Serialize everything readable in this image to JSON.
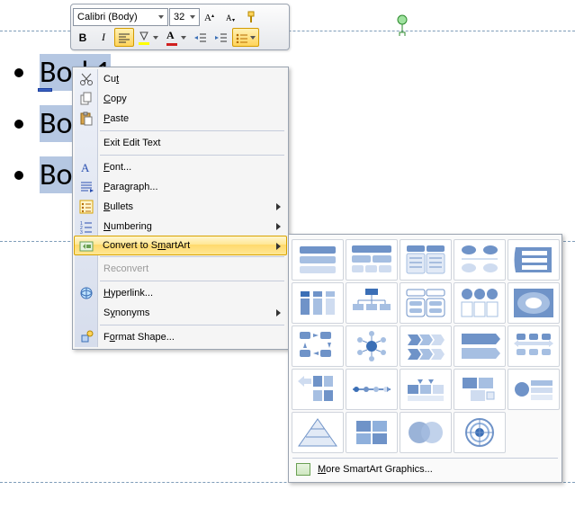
{
  "toolbar": {
    "font_name": "Calibri (Body)",
    "font_size": "32"
  },
  "bullets": {
    "items": [
      "Bod 1",
      "Bo",
      "Bo"
    ]
  },
  "context_menu": {
    "cut": "Cut",
    "copy": "Copy",
    "paste": "Paste",
    "exit_edit": "Exit Edit Text",
    "font": "Font...",
    "paragraph": "Paragraph...",
    "bullets": "Bullets",
    "numbering": "Numbering",
    "convert_smartart": "Convert to SmartArt",
    "reconvert": "Reconvert",
    "hyperlink": "Hyperlink...",
    "synonyms": "Synonyms",
    "format_shape": "Format Shape..."
  },
  "gallery": {
    "more": "More SmartArt Graphics..."
  },
  "chart_data": null
}
